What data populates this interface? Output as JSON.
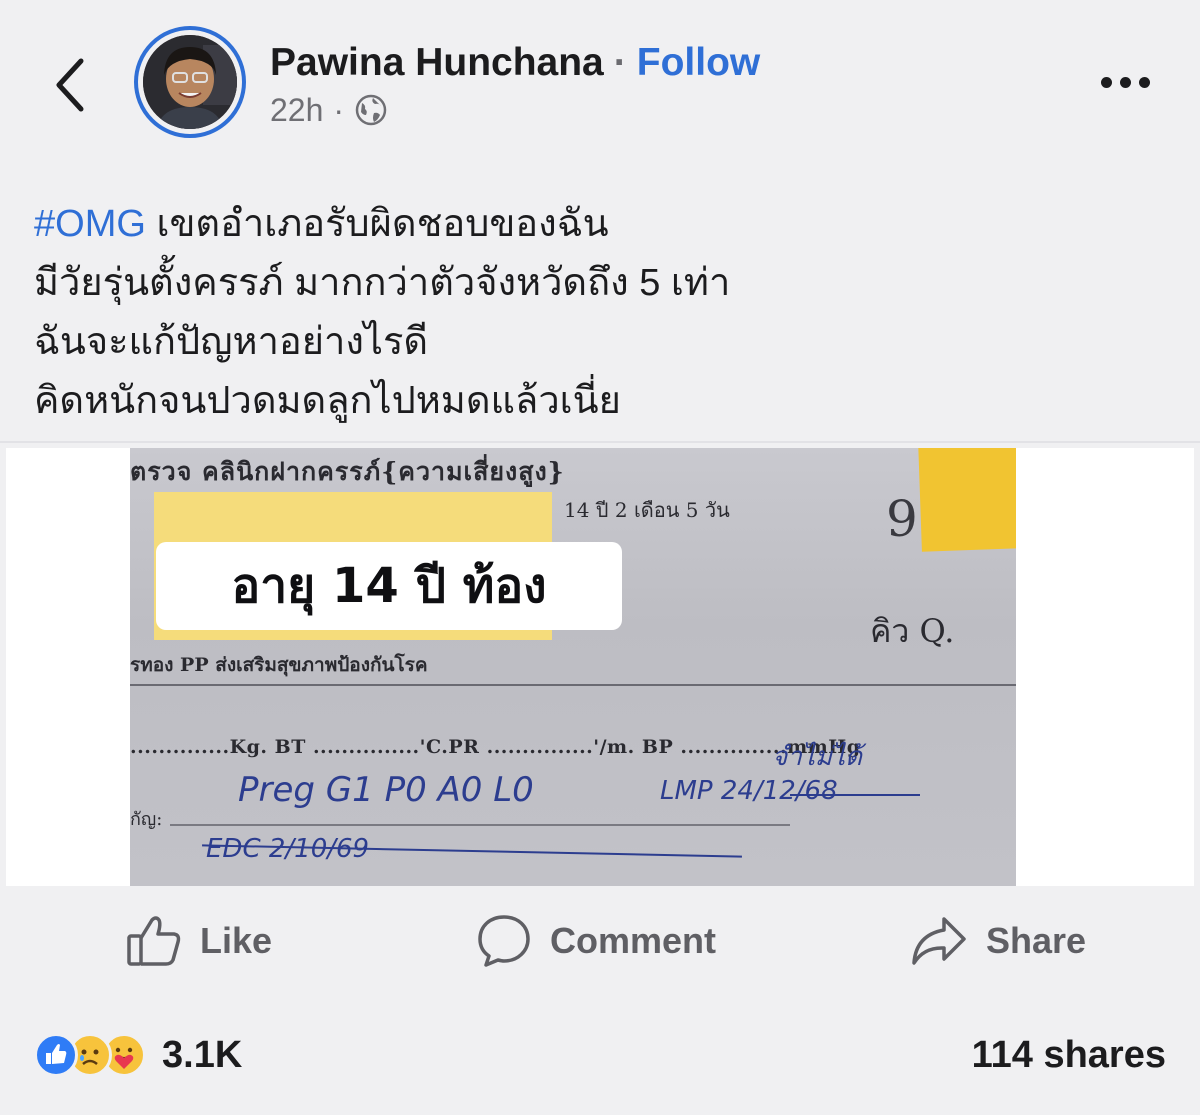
{
  "header": {
    "author_name": "Pawina Hunchana",
    "separator": "·",
    "follow_label": "Follow",
    "timestamp": "22h",
    "meta_separator": "·",
    "audience_icon": "globe-icon",
    "back_icon": "chevron-left-icon",
    "more_icon": "more-horizontal-icon"
  },
  "post": {
    "hashtag": "#OMG",
    "lines": [
      " เขตอำเภอรับผิดชอบของฉัน",
      "มีวัยรุ่นตั้งครรภ์ มากกว่าตัวจังหวัดถึง 5 เท่า",
      "ฉันจะแก้ปัญหาอย่างไรดี",
      "คิดหนักจนปวดมดลูกไปหมดแล้วเนี่ย"
    ]
  },
  "media": {
    "overlay_text": "อายุ 14 ปี ท้อง",
    "doc_title": "ตรวจ  คลินิกฝากครรภ์{ความเสี่ยงสูง}",
    "age_text": "14 ปี  2 เดือน  5  วัน",
    "sticky_number": "9",
    "queue_text": "คิว Q.",
    "service_text": "รทอง PP ส่งเสริมสุขภาพป้องกันโรค",
    "vitals_text": "..............Kg.  BT ...............'C.PR ...............'/m.  BP ...............mmHg",
    "diag_label": "กัญ:",
    "handwriting_1": "Preg  G1 P0 A0 L0",
    "handwriting_2": "LMP  24/12/68",
    "handwriting_3": "EDC  2/10/69",
    "handwriting_4": "จำไม่ได้"
  },
  "actions": {
    "like_label": "Like",
    "comment_label": "Comment",
    "share_label": "Share"
  },
  "footer": {
    "reaction_count": "3.1K",
    "shares_text": "114 shares",
    "reaction_icons": [
      "like-reaction-icon",
      "sad-reaction-icon",
      "care-reaction-icon"
    ]
  },
  "colors": {
    "accent": "#2f6fd6",
    "background": "#f0f0f2",
    "muted_text": "#6f6f74"
  }
}
